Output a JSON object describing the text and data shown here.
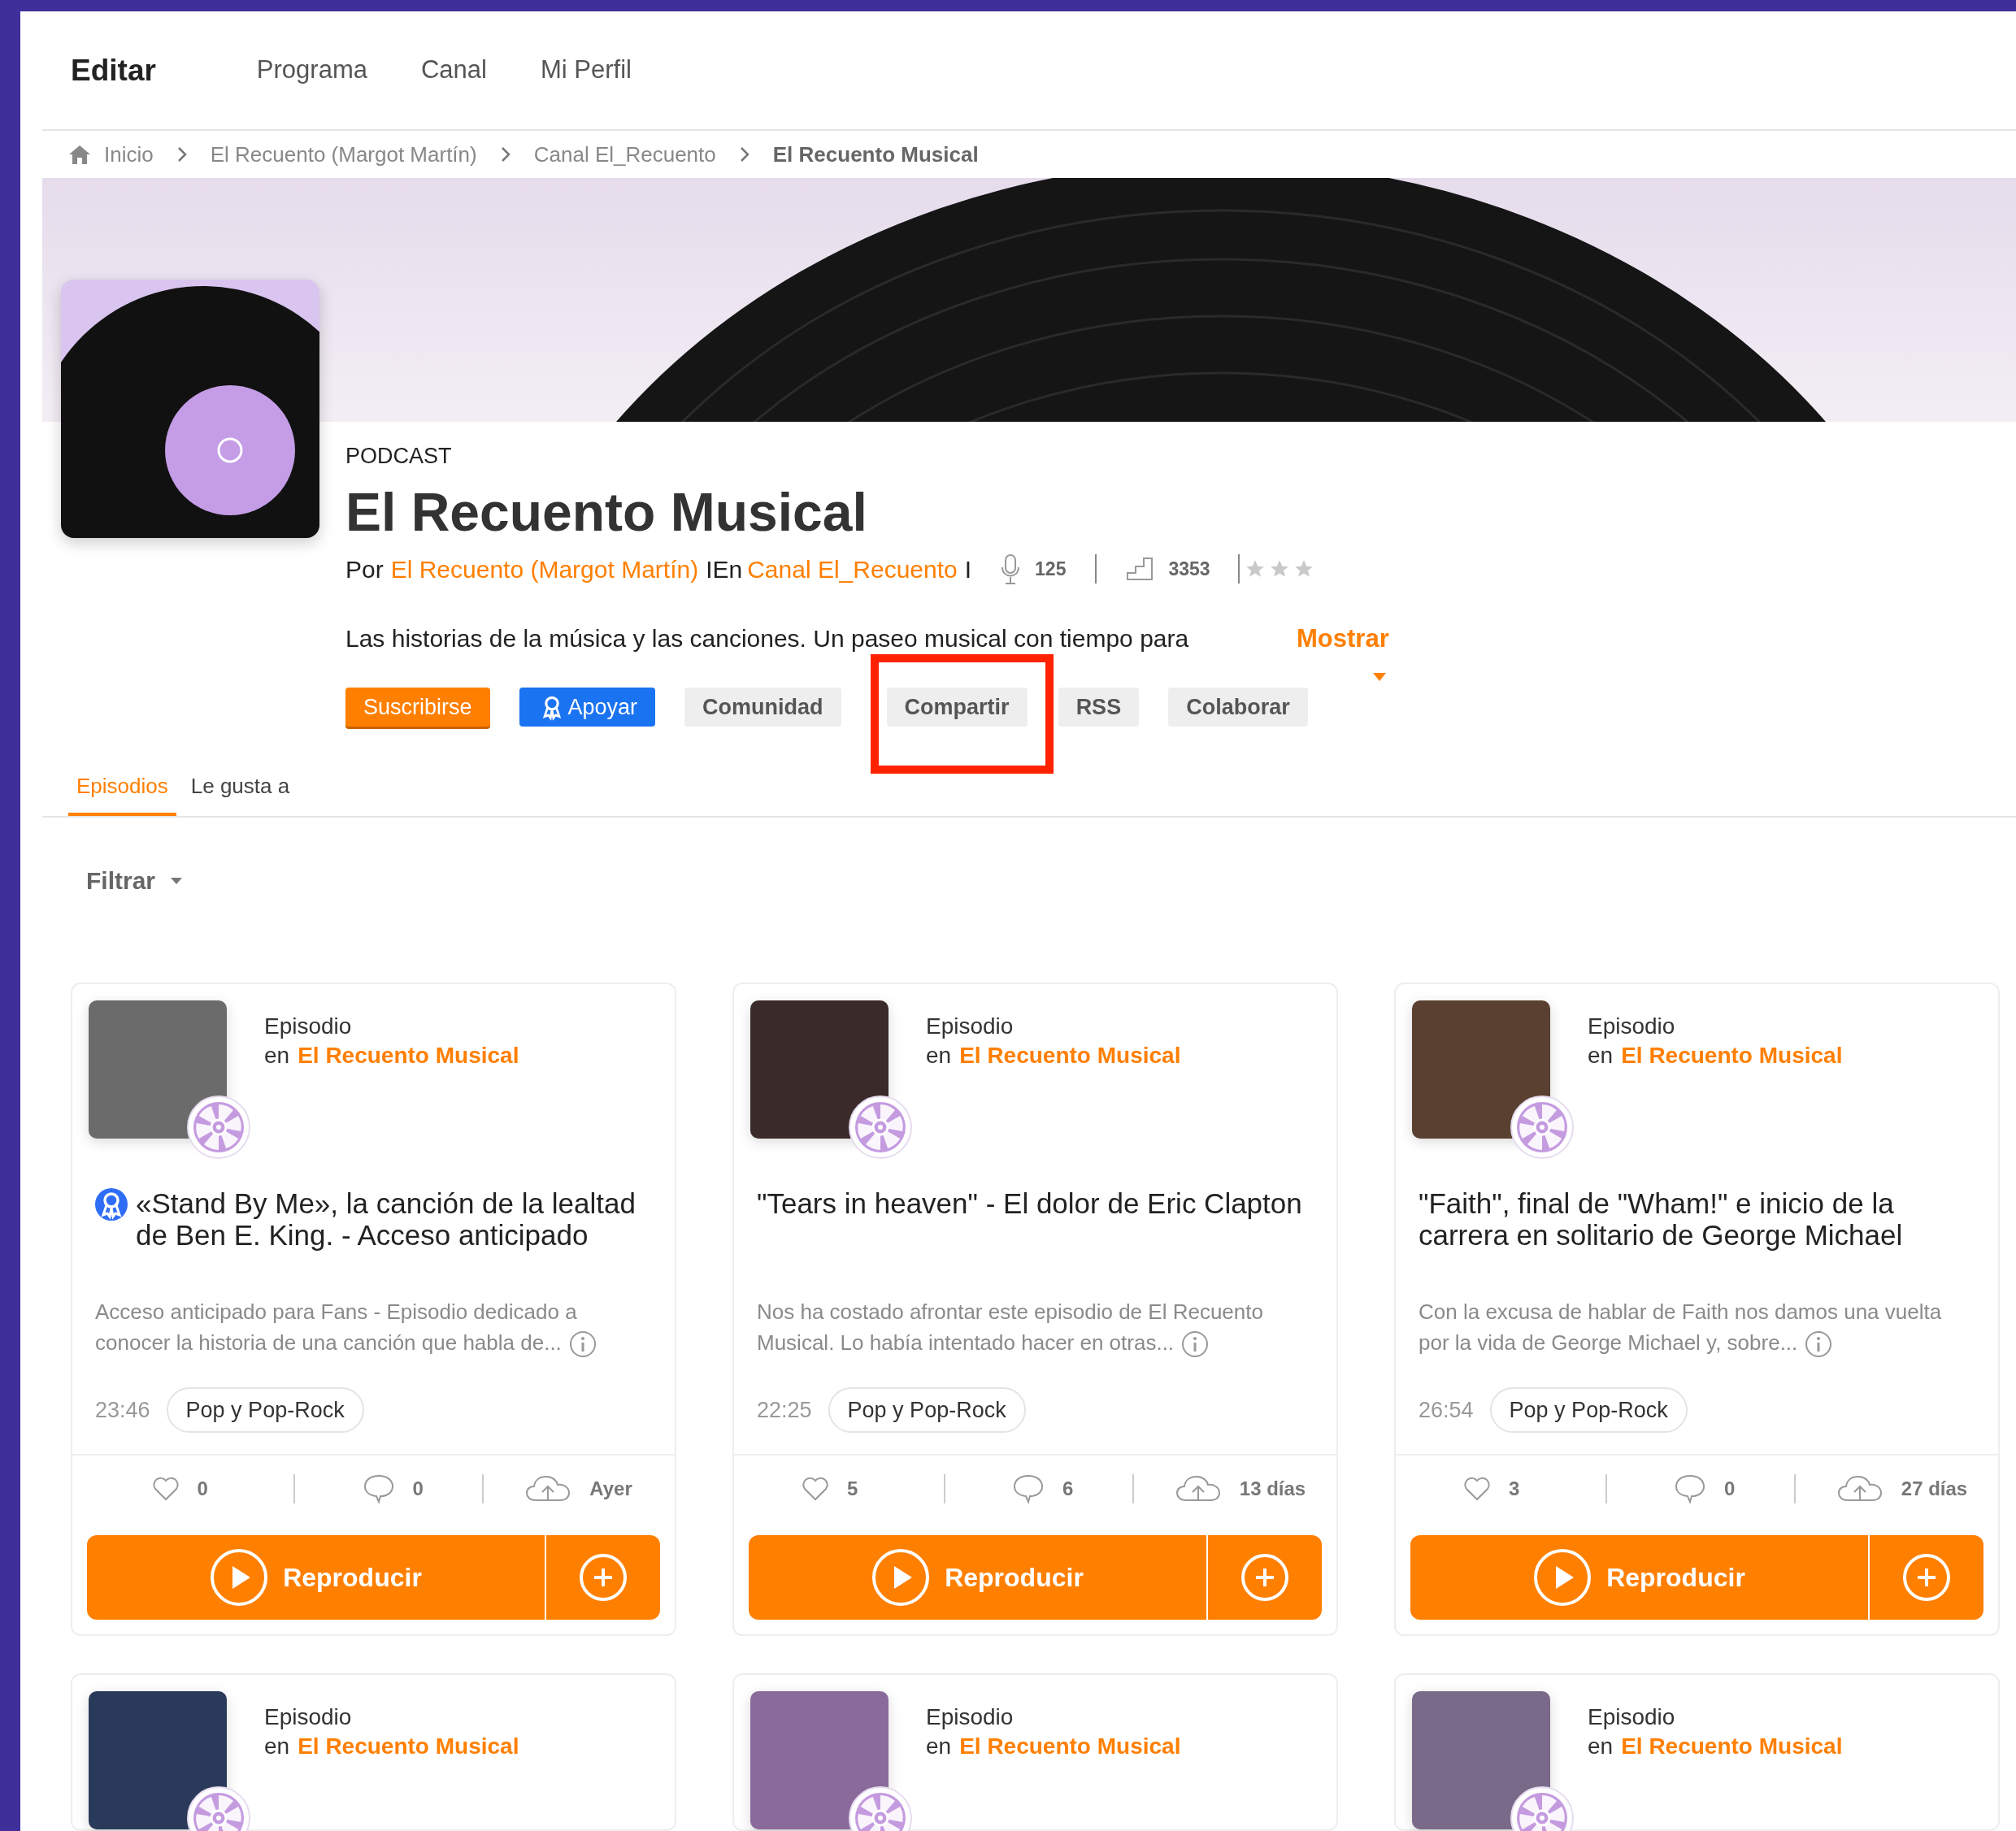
{
  "nav": {
    "title": "Editar",
    "items": [
      "Programa",
      "Canal",
      "Mi Perfil"
    ]
  },
  "breadcrumb": [
    {
      "label": "Inicio",
      "current": false
    },
    {
      "label": "El Recuento (Margot Martín)",
      "current": false
    },
    {
      "label": "Canal El_Recuento",
      "current": false
    },
    {
      "label": "El Recuento Musical",
      "current": true
    }
  ],
  "podcast": {
    "type_label": "PODCAST",
    "title": "El Recuento Musical",
    "by_label": "Por",
    "author": "El Recuento (Margot Martín)",
    "in_label": "IEn",
    "channel": "Canal El_Recuento",
    "end_mark": "I",
    "episodes_count": "125",
    "followers": "3353",
    "stars": 0,
    "description": "Las historias de la música y las canciones. Un paseo musical con tiempo para",
    "more_label": "Mostrar"
  },
  "actions": [
    {
      "label": "Suscribirse",
      "kind": "primary",
      "highlighted": false
    },
    {
      "label": "Apoyar",
      "kind": "support",
      "highlighted": false
    },
    {
      "label": "Comunidad",
      "kind": "secondary",
      "highlighted": false
    },
    {
      "label": "Compartir",
      "kind": "secondary",
      "highlighted": true
    },
    {
      "label": "RSS",
      "kind": "secondary",
      "highlighted": false
    },
    {
      "label": "Colaborar",
      "kind": "secondary",
      "highlighted": false
    }
  ],
  "tabs": [
    {
      "label": "Episodios",
      "selected": true
    },
    {
      "label": "Le gusta a",
      "selected": false
    }
  ],
  "filter": {
    "label": "Filtrar"
  },
  "episodes": [
    {
      "type_label": "Episodio",
      "in_label": "en",
      "show": "El Recuento Musical",
      "fans_only": true,
      "title": "«Stand By Me», la canción de la lealtad de Ben E. King. - Acceso anticipado",
      "description": "Acceso anticipado para Fans - Episodio dedicado a conocer la historia de una canción que habla de...",
      "duration": "23:46",
      "genre": "Pop y Pop-Rock",
      "likes": "0",
      "comments": "0",
      "published": "Ayer",
      "play_label": "Reproducir"
    },
    {
      "type_label": "Episodio",
      "in_label": "en",
      "show": "El Recuento Musical",
      "fans_only": false,
      "title": "\"Tears in heaven\" - El dolor de Eric Clapton",
      "description": "Nos ha costado afrontar este episodio de El Recuento Musical. Lo había intentado hacer en otras...",
      "duration": "22:25",
      "genre": "Pop y Pop-Rock",
      "likes": "5",
      "comments": "6",
      "published": "13 días",
      "play_label": "Reproducir"
    },
    {
      "type_label": "Episodio",
      "in_label": "en",
      "show": "El Recuento Musical",
      "fans_only": false,
      "title": "\"Faith\", final de \"Wham!\" e inicio de la carrera en solitario de George Michael",
      "description": "Con la excusa de hablar de Faith nos damos una vuelta por la vida de George Michael y, sobre...",
      "duration": "26:54",
      "genre": "Pop y Pop-Rock",
      "likes": "3",
      "comments": "0",
      "published": "27 días",
      "play_label": "Reproducir"
    },
    {
      "type_label": "Episodio",
      "in_label": "en",
      "show": "El Recuento Musical"
    },
    {
      "type_label": "Episodio",
      "in_label": "en",
      "show": "El Recuento Musical"
    },
    {
      "type_label": "Episodio",
      "in_label": "en",
      "show": "El Recuento Musical"
    }
  ]
}
